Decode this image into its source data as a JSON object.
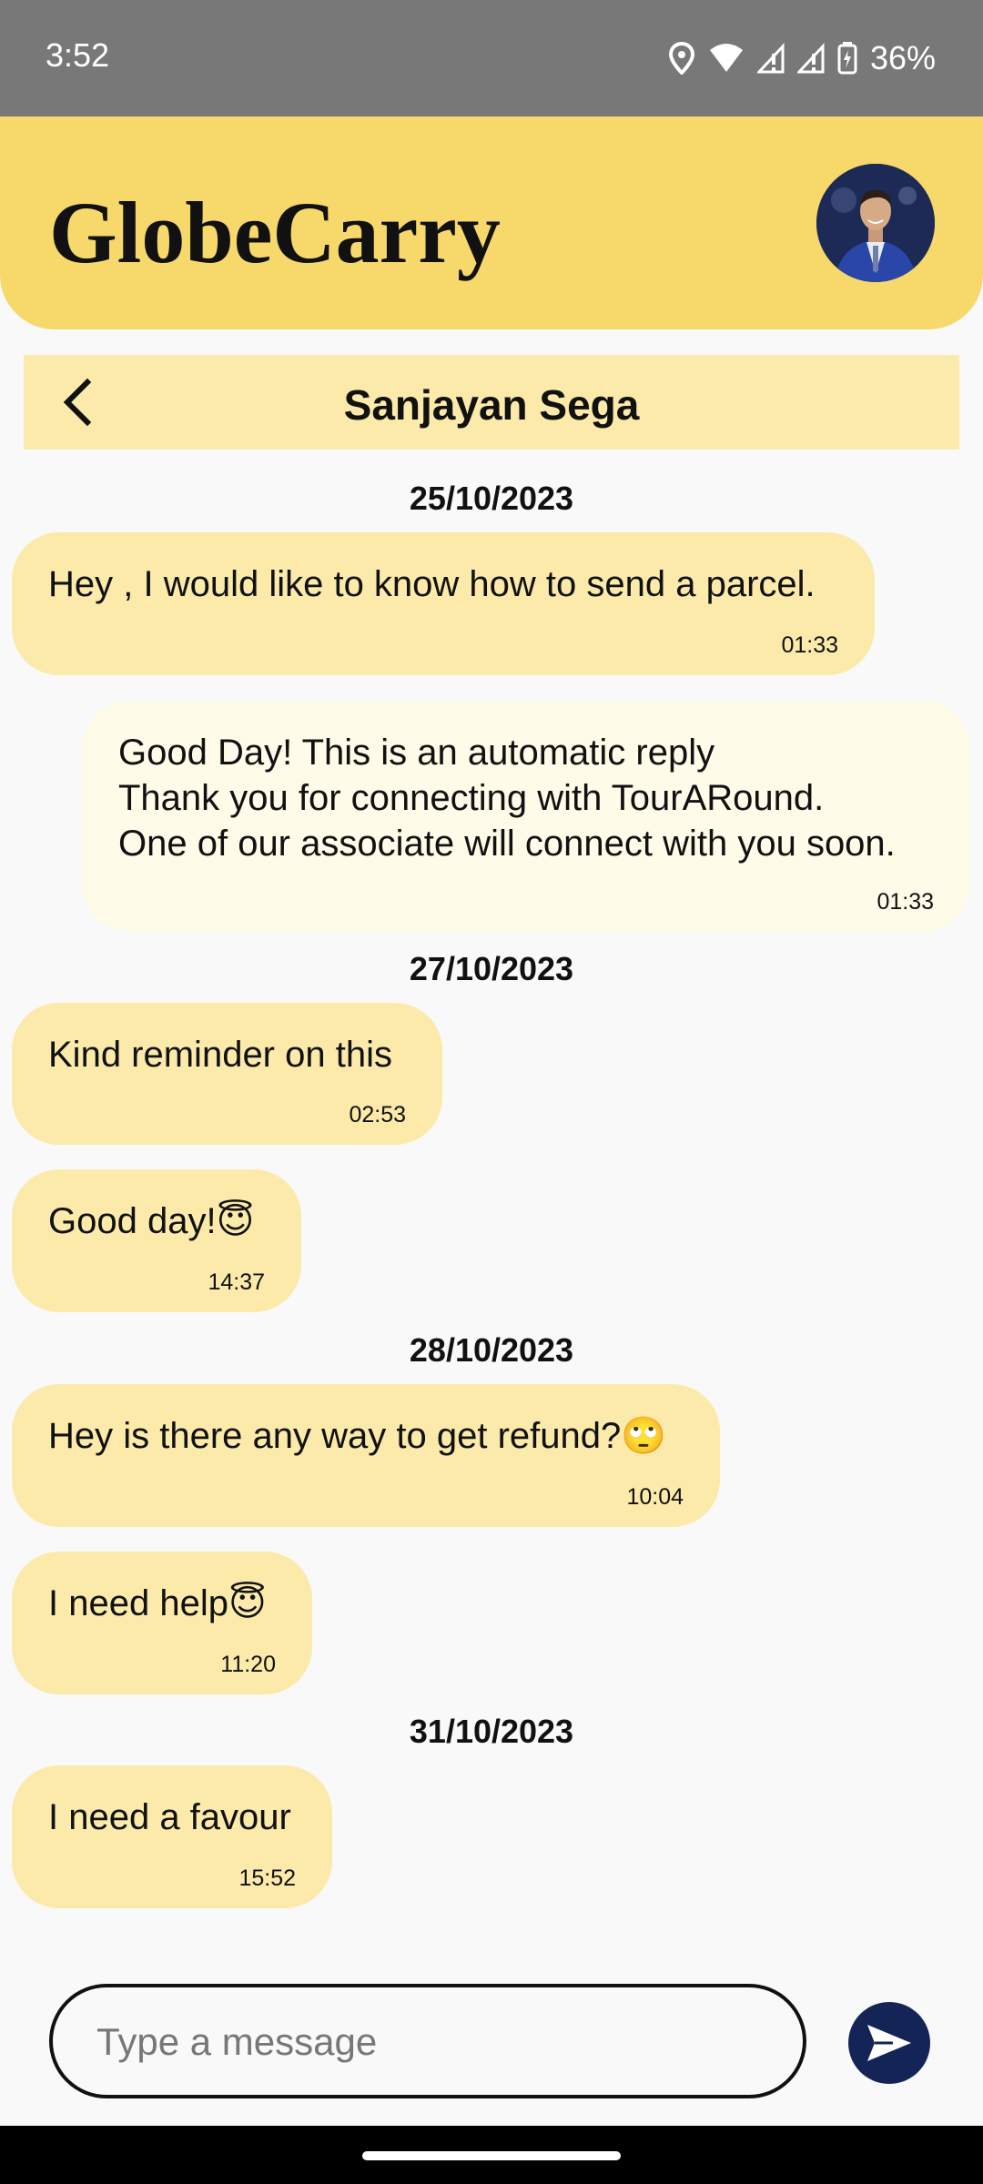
{
  "status_bar": {
    "time": "3:52",
    "battery": "36%",
    "icons": [
      "location-icon",
      "wifi-icon",
      "signal-icon",
      "signal-icon",
      "battery-charging-icon"
    ]
  },
  "header": {
    "app_title": "GlobeCarry",
    "avatar": "profile-avatar"
  },
  "chat": {
    "contact_name": "Sanjayan Sega",
    "back_icon": "chevron-left-icon"
  },
  "dates": [
    "25/10/2023",
    "27/10/2023",
    "28/10/2023",
    "31/10/2023"
  ],
  "messages": [
    {
      "text": "Hey , I would like to know how to send a parcel.",
      "time": "01:33",
      "direction": "incoming"
    },
    {
      "text": "Good Day! This is an automatic reply\nThank you for connecting with TourARound.\nOne of our associate will connect with you soon.",
      "time": "01:33",
      "direction": "outgoing"
    },
    {
      "text": "Kind reminder on this",
      "time": "02:53",
      "direction": "incoming"
    },
    {
      "text": "Good day!😇",
      "time": "14:37",
      "direction": "incoming"
    },
    {
      "text": "Hey is there any way to get refund?🙄",
      "time": "10:04",
      "direction": "incoming"
    },
    {
      "text": "I need help😇",
      "time": "11:20",
      "direction": "incoming"
    },
    {
      "text": "I need a favour",
      "time": "15:52",
      "direction": "incoming"
    }
  ],
  "composer": {
    "placeholder": "Type a message",
    "send_icon": "send-icon"
  },
  "colors": {
    "header": "#f7d86a",
    "incoming_bubble": "#fbeaaa",
    "outgoing_bubble": "#fefbe8",
    "send_button": "#142457"
  }
}
